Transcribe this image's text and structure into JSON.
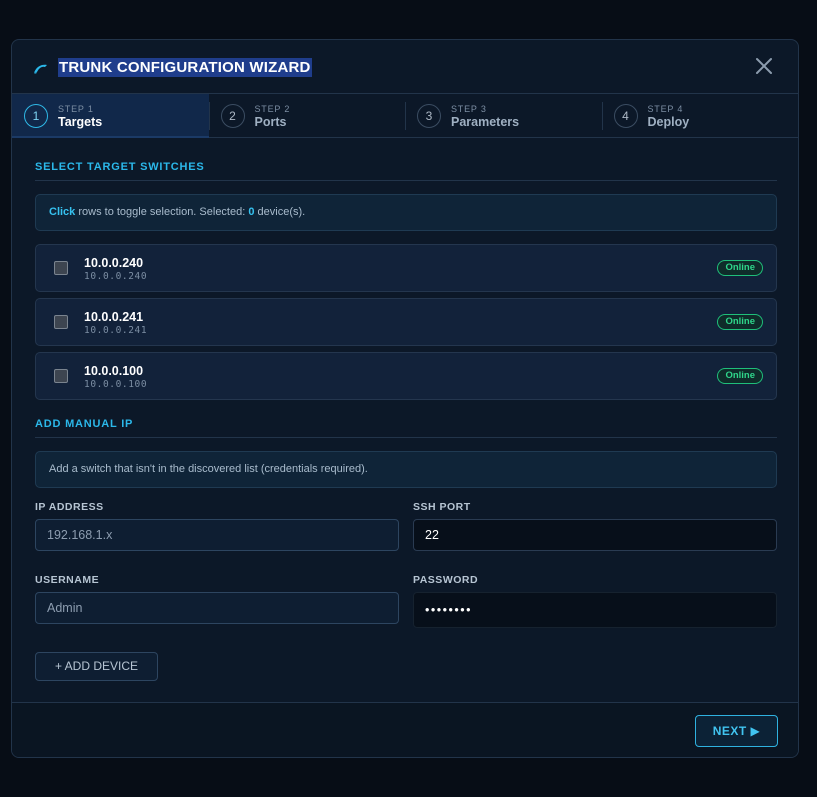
{
  "header": {
    "title": "TRUNK CONFIGURATION WIZARD",
    "logo_icon": "dolphin-logo-icon",
    "close_icon": "close-icon"
  },
  "steps": [
    {
      "number": "1",
      "sub": "STEP 1",
      "label": "Targets",
      "active": true
    },
    {
      "number": "2",
      "sub": "STEP 2",
      "label": "Ports",
      "active": false
    },
    {
      "number": "3",
      "sub": "STEP 3",
      "label": "Parameters",
      "active": false
    },
    {
      "number": "4",
      "sub": "STEP 4",
      "label": "Deploy",
      "active": false
    }
  ],
  "targets": {
    "section_title": "SELECT TARGET SWITCHES",
    "info_prefix": "Click",
    "info_middle": " rows to toggle selection. Selected: ",
    "selected_count": "0",
    "info_suffix": " device(s).",
    "devices": [
      {
        "name": "10.0.0.240",
        "ip": "10.0.0.240",
        "status": "Online",
        "selected": false
      },
      {
        "name": "10.0.0.241",
        "ip": "10.0.0.241",
        "status": "Online",
        "selected": false
      },
      {
        "name": "10.0.0.100",
        "ip": "10.0.0.100",
        "status": "Online",
        "selected": false
      }
    ]
  },
  "manual": {
    "section_title": "ADD MANUAL IP",
    "info": "Add a switch that isn't in the discovered list (credentials required).",
    "ip_label": "IP ADDRESS",
    "ip_placeholder": "192.168.1.x",
    "port_label": "SSH PORT",
    "port_value": "22",
    "username_label": "USERNAME",
    "username_placeholder": "Admin",
    "password_label": "PASSWORD",
    "password_value": "••••••••",
    "add_button": "+ ADD DEVICE"
  },
  "footer": {
    "next_button": "NEXT ▶"
  },
  "colors": {
    "accent": "#2bb8ea",
    "online": "#2fd68b",
    "background": "#0c1828"
  }
}
